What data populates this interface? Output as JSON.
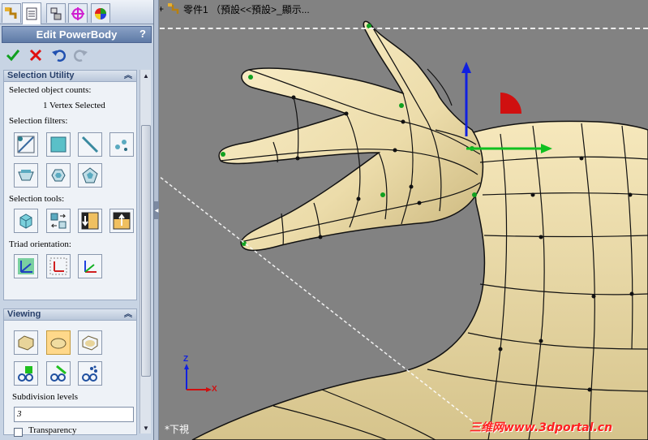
{
  "panel": {
    "tabs": [
      "feature-manager",
      "property-manager",
      "configuration-manager",
      "dimxpert-manager",
      "display-manager"
    ],
    "title": "Edit PowerBody",
    "help": "?"
  },
  "selection_utility": {
    "header": "Selection Utility",
    "counts_label": "Selected object counts:",
    "count_value": "1 Vertex Selected",
    "filters_label": "Selection filters:",
    "tools_label": "Selection tools:",
    "triad_label": "Triad orientation:"
  },
  "viewing": {
    "header": "Viewing",
    "subdivision_label": "Subdivision levels",
    "subdivision_value": "3",
    "transparency_label": "Transparency"
  },
  "viewport": {
    "tree_crumb": "零件1 （預設<<預設>_顯示...",
    "view_label": "*下視",
    "watermark": "三维网www.3dportal.cn",
    "axis_z": "Z",
    "axis_x": "X"
  },
  "colors": {
    "surface": "#f0e2b8",
    "background": "#828282",
    "triad_blue": "#1020e0",
    "triad_green": "#10c020",
    "arc_red": "#d01010"
  }
}
